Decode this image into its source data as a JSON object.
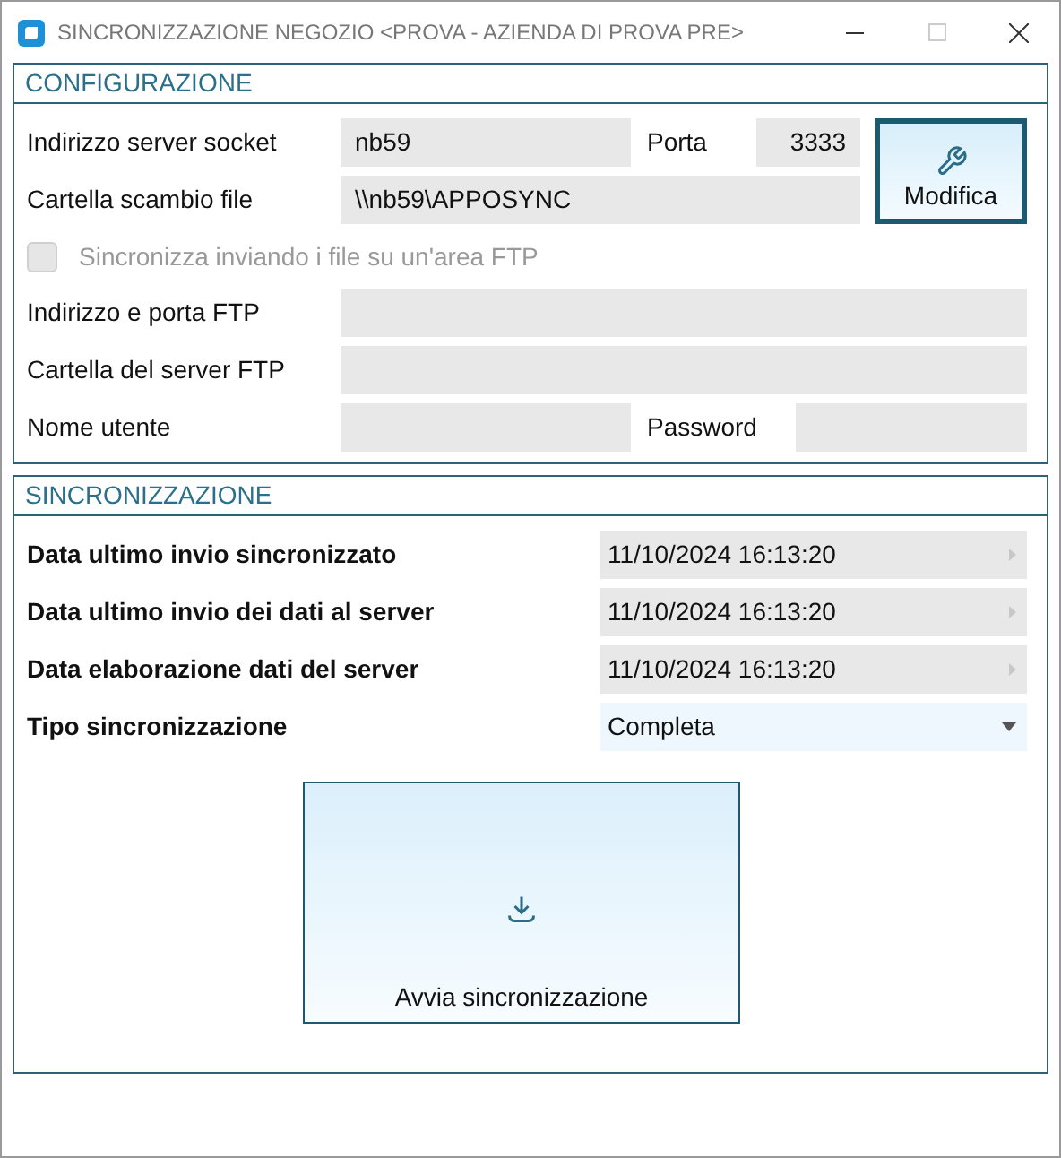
{
  "window": {
    "title": "SINCRONIZZAZIONE NEGOZIO <PROVA - AZIENDA DI PROVA PRE>"
  },
  "configurazione": {
    "title": "CONFIGURAZIONE",
    "server_label": "Indirizzo server socket",
    "server_value": "nb59",
    "porta_label": "Porta",
    "porta_value": "3333",
    "cartella_label": "Cartella scambio file",
    "cartella_value": "\\\\nb59\\APPOSYNC",
    "modifica_button": "Modifica",
    "ftp_checkbox": {
      "label": "Sincronizza inviando i file su un'area FTP",
      "checked": false,
      "disabled": true
    },
    "ftp_address_label": "Indirizzo e porta FTP",
    "ftp_folder_label": "Cartella del server FTP",
    "user_label": "Nome utente",
    "password_label": "Password"
  },
  "sincronizzazione": {
    "title": "SINCRONIZZAZIONE",
    "rows": [
      {
        "kind": "date",
        "label": "Data ultimo invio sincronizzato",
        "value": "11/10/2024 16:13:20"
      },
      {
        "kind": "date",
        "label": "Data ultimo invio dei dati al server",
        "value": "11/10/2024 16:13:20"
      },
      {
        "kind": "date",
        "label": "Data elaborazione dati del server",
        "value": "11/10/2024 16:13:20"
      },
      {
        "kind": "dropdown",
        "label": "Tipo sincronizzazione",
        "value": "Completa"
      }
    ],
    "start_button": "Avvia sincronizzazione"
  }
}
